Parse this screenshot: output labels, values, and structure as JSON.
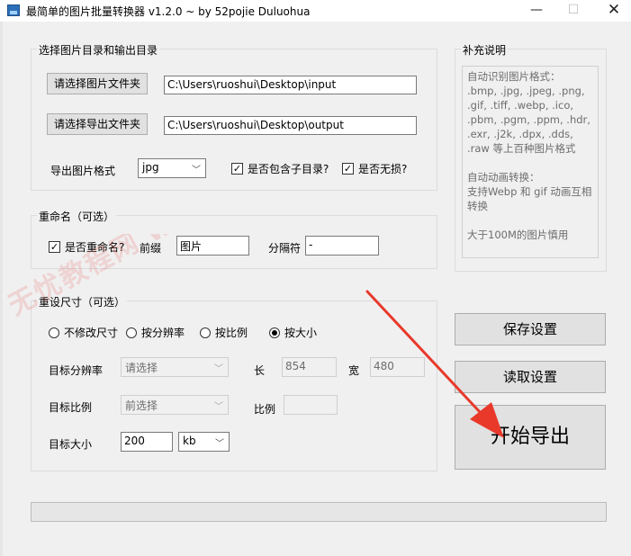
{
  "window": {
    "title": "最简单的图片批量转换器 v1.2.0 ~ by 52pojie Duluohua",
    "min_glyph": "—",
    "max_glyph": "☐",
    "close_glyph": "✕"
  },
  "dirs": {
    "group_title": "选择图片目录和输出目录",
    "input_button": "请选择图片文件夹",
    "input_path": "C:\\Users\\ruoshui\\Desktop\\input",
    "output_button": "请选择导出文件夹",
    "output_path": "C:\\Users\\ruoshui\\Desktop\\output",
    "format_label": "导出图片格式",
    "format_value": "jpg",
    "include_subdirs_label": "是否包含子目录?",
    "include_subdirs_checked": true,
    "lossless_label": "是否无损?",
    "lossless_checked": true
  },
  "rename": {
    "group_title": "重命名（可选）",
    "enable_label": "是否重命名?",
    "enable_checked": true,
    "prefix_label": "前缀",
    "prefix_value": "图片",
    "separator_label": "分隔符",
    "separator_value": "-"
  },
  "resize": {
    "group_title": "重设尺寸（可选）",
    "modes": [
      {
        "label": "不修改尺寸",
        "selected": false
      },
      {
        "label": "按分辨率",
        "selected": false
      },
      {
        "label": "按比例",
        "selected": false
      },
      {
        "label": "按大小",
        "selected": true
      }
    ],
    "resolution_label": "目标分辨率",
    "resolution_placeholder": "请选择",
    "length_label": "长",
    "length_value": "854",
    "width_label": "宽",
    "width_value": "480",
    "ratio_label": "目标比例",
    "ratio_placeholder": "前选择",
    "ratio_value_label": "比例",
    "ratio_value": "",
    "size_label": "目标大小",
    "size_value": "200",
    "size_unit": "kb"
  },
  "notes": {
    "group_title": "补充说明",
    "formats_text": "自动识别图片格式：\n.bmp, .jpg, .jpeg, .png, .gif, .tiff, .webp, .ico, .pbm, .pgm, .ppm, .hdr, .exr, .j2k, .dpx, .dds, .raw 等上百种图片格式",
    "animation_text": "自动动画转换：\n支持Webp 和 gif 动画互相转换",
    "warning_text": "大于100M的图片慎用"
  },
  "actions": {
    "save_label": "保存设置",
    "load_label": "读取设置",
    "start_label": "开始导出"
  },
  "progress": {
    "value": 0
  },
  "watermark": {
    "text": "无忧教程网 www.52pojie.com"
  },
  "colors": {
    "annotation_arrow": "#e8392b",
    "progress_fill": "#06b025"
  }
}
